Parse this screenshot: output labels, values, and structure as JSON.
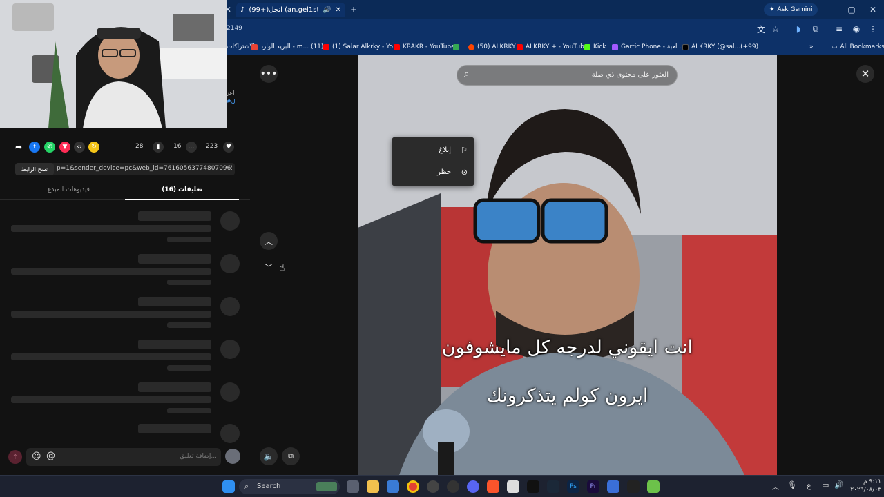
{
  "browser": {
    "tab_title": "(99+)انجل (an.gel1st@) | ok",
    "url_fragment": "2149",
    "ask_gemini": "Ask Gemini",
    "all_bookmarks": "All Bookmarks",
    "bookmarks": [
      "الاشتراكات",
      "البريد الوارد - m... (11)",
      "(1) Salar Alkrky - Yo...",
      "KRAKR - YouTube",
      "(50) ALKRKY",
      "ALKRKY + - YouTube",
      "Kick",
      "Gartic Phone - لعبة ...",
      "ALKRKY (@sal...(+99)"
    ]
  },
  "panel": {
    "likes": "223",
    "comments": "16",
    "saves": "28",
    "link_text": "p=1&sender_device=pc&web_id=7616056377480709652...",
    "copy_link": "نسخ الرابط",
    "tab_comments": "تعليقات (16)",
    "tab_creator_videos": "فيديوهات المبدع",
    "add_comment_placeholder": "إضافة تعليق...",
    "at_symbol": "@",
    "side_text_1": "اعر",
    "side_text_2": "#ال"
  },
  "video": {
    "search_placeholder": "العثور على محتوى ذي صلة",
    "menu_report": "إبلاغ",
    "menu_block": "حظر",
    "caption_line1": "انت ايقوني لدرجه كل مايشوفون",
    "caption_line2": "ايرون كولم يتذكرونك"
  },
  "taskbar": {
    "search": "Search",
    "lang": "ع",
    "time": "٩:١١ م",
    "date": "٢٠٢٦/٠٨/٠٣"
  },
  "colors": {
    "tab_bg": "#0b2a57",
    "toolbar_bg": "#0d3168",
    "panel_bg": "#121212",
    "accent_red": "#fe2c55"
  }
}
